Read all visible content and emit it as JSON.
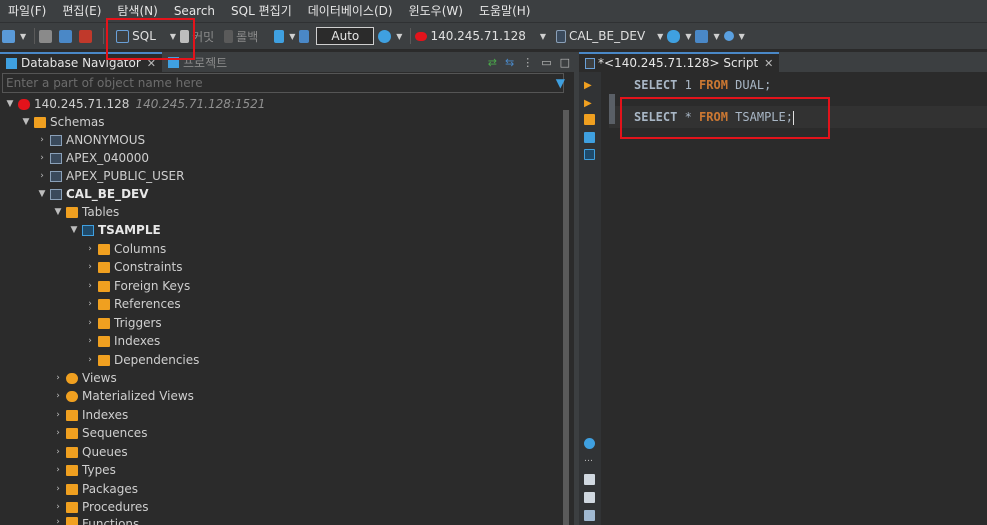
{
  "menu": [
    "파일(F)",
    "편집(E)",
    "탐색(N)",
    "Search",
    "SQL 편집기",
    "데이터베이스(D)",
    "윈도우(W)",
    "도움말(H)"
  ],
  "toolbar": {
    "sql_label": "SQL",
    "commit_label": "커밋",
    "rollback_label": "롤백",
    "mode_value": "Auto",
    "datasource": "140.245.71.128",
    "schema": "CAL_BE_DEV"
  },
  "navigator": {
    "tab_label": "Database Navigator",
    "tab2_label": "프로젝트",
    "filter_placeholder": "Enter a part of object name here",
    "connection_name": "140.245.71.128",
    "connection_detail": "140.245.71.128:1521",
    "schemas_label": "Schemas",
    "schemas": [
      "ANONYMOUS",
      "APEX_040000",
      "APEX_PUBLIC_USER"
    ],
    "current_schema": "CAL_BE_DEV",
    "tables_label": "Tables",
    "table_name": "TSAMPLE",
    "table_children": [
      "Columns",
      "Constraints",
      "Foreign Keys",
      "References",
      "Triggers",
      "Indexes",
      "Dependencies"
    ],
    "schema_children": [
      "Views",
      "Materialized Views",
      "Indexes",
      "Sequences",
      "Queues",
      "Types",
      "Packages",
      "Procedures",
      "Functions"
    ]
  },
  "editor": {
    "tab_label": "*<140.245.71.128> Script",
    "line1": {
      "kw1": "SELECT",
      "mid": " 1 ",
      "kw2": "FROM",
      "tail": " DUAL;"
    },
    "line2": {
      "kw1": "SELECT",
      "mid": " * ",
      "kw2": "FROM",
      "tail": " TSAMPLE;"
    }
  },
  "colors": {
    "highlight": "#e3131b",
    "keyword": "#cc7832",
    "folder": "#f0a020",
    "accent": "#3fa0e0"
  }
}
